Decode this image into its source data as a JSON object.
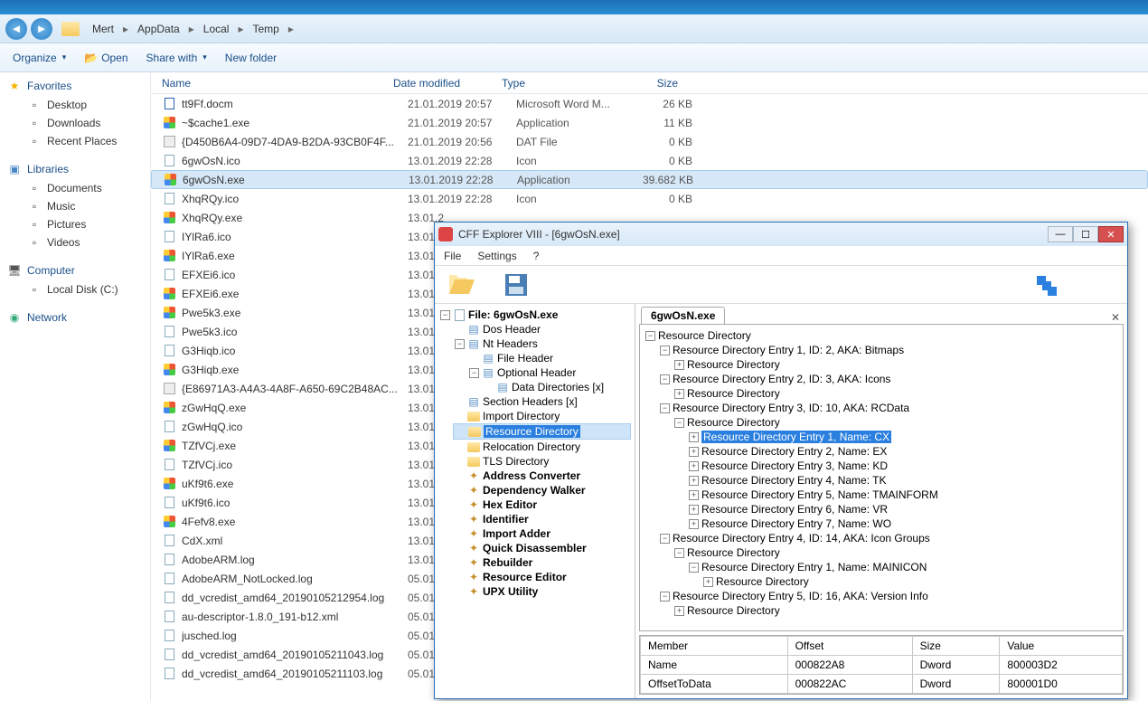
{
  "breadcrumb": [
    "Mert",
    "AppData",
    "Local",
    "Temp"
  ],
  "toolbar": {
    "organize": "Organize",
    "open": "Open",
    "share": "Share with",
    "newfolder": "New folder"
  },
  "sidebar": {
    "favorites": {
      "label": "Favorites",
      "items": [
        "Desktop",
        "Downloads",
        "Recent Places"
      ]
    },
    "libraries": {
      "label": "Libraries",
      "items": [
        "Documents",
        "Music",
        "Pictures",
        "Videos"
      ]
    },
    "computer": {
      "label": "Computer",
      "items": [
        "Local Disk (C:)"
      ]
    },
    "network": {
      "label": "Network"
    }
  },
  "columns": {
    "name": "Name",
    "date": "Date modified",
    "type": "Type",
    "size": "Size"
  },
  "files": [
    {
      "icon": "doc",
      "name": "tt9Ff.docm",
      "date": "21.01.2019 20:57",
      "type": "Microsoft Word M...",
      "size": "26 KB"
    },
    {
      "icon": "app",
      "name": "~$cache1.exe",
      "date": "21.01.2019 20:57",
      "type": "Application",
      "size": "11 KB"
    },
    {
      "icon": "dat",
      "name": "{D450B6A4-09D7-4DA9-B2DA-93CB0F4F...",
      "date": "21.01.2019 20:56",
      "type": "DAT File",
      "size": "0 KB"
    },
    {
      "icon": "file",
      "name": "6gwOsN.ico",
      "date": "13.01.2019 22:28",
      "type": "Icon",
      "size": "0 KB"
    },
    {
      "icon": "chrome",
      "name": "6gwOsN.exe",
      "date": "13.01.2019 22:28",
      "type": "Application",
      "size": "39.682 KB",
      "selected": true
    },
    {
      "icon": "file",
      "name": "XhqRQy.ico",
      "date": "13.01.2019 22:28",
      "type": "Icon",
      "size": "0 KB"
    },
    {
      "icon": "chrome",
      "name": "XhqRQy.exe",
      "date": "13.01.2",
      "type": "",
      "size": ""
    },
    {
      "icon": "file",
      "name": "IYlRa6.ico",
      "date": "13.01.2",
      "type": "",
      "size": ""
    },
    {
      "icon": "chrome",
      "name": "IYlRa6.exe",
      "date": "13.01.2",
      "type": "",
      "size": ""
    },
    {
      "icon": "file",
      "name": "EFXEi6.ico",
      "date": "13.01.2",
      "type": "",
      "size": ""
    },
    {
      "icon": "chrome",
      "name": "EFXEi6.exe",
      "date": "13.01.2",
      "type": "",
      "size": ""
    },
    {
      "icon": "chrome",
      "name": "Pwe5k3.exe",
      "date": "13.01.2",
      "type": "",
      "size": ""
    },
    {
      "icon": "file",
      "name": "Pwe5k3.ico",
      "date": "13.01.2",
      "type": "",
      "size": ""
    },
    {
      "icon": "file",
      "name": "G3Hiqb.ico",
      "date": "13.01.2",
      "type": "",
      "size": ""
    },
    {
      "icon": "chrome",
      "name": "G3Hiqb.exe",
      "date": "13.01.2",
      "type": "",
      "size": ""
    },
    {
      "icon": "dat",
      "name": "{E86971A3-A4A3-4A8F-A650-69C2B48AC...",
      "date": "13.01.2",
      "type": "",
      "size": ""
    },
    {
      "icon": "chrome",
      "name": "zGwHqQ.exe",
      "date": "13.01.2",
      "type": "",
      "size": ""
    },
    {
      "icon": "file",
      "name": "zGwHqQ.ico",
      "date": "13.01.2",
      "type": "",
      "size": ""
    },
    {
      "icon": "chrome",
      "name": "TZfVCj.exe",
      "date": "13.01.2",
      "type": "",
      "size": ""
    },
    {
      "icon": "file",
      "name": "TZfVCj.ico",
      "date": "13.01.2",
      "type": "",
      "size": ""
    },
    {
      "icon": "chrome",
      "name": "uKf9t6.exe",
      "date": "13.01.2",
      "type": "",
      "size": ""
    },
    {
      "icon": "file",
      "name": "uKf9t6.ico",
      "date": "13.01.2",
      "type": "",
      "size": ""
    },
    {
      "icon": "chrome",
      "name": "4Fefv8.exe",
      "date": "13.01.2",
      "type": "",
      "size": ""
    },
    {
      "icon": "file",
      "name": "CdX.xml",
      "date": "13.01.2",
      "type": "",
      "size": ""
    },
    {
      "icon": "file",
      "name": "AdobeARM.log",
      "date": "13.01.2",
      "type": "",
      "size": ""
    },
    {
      "icon": "file",
      "name": "AdobeARM_NotLocked.log",
      "date": "05.01.2",
      "type": "",
      "size": ""
    },
    {
      "icon": "file",
      "name": "dd_vcredist_amd64_20190105212954.log",
      "date": "05.01.2",
      "type": "",
      "size": ""
    },
    {
      "icon": "file",
      "name": "au-descriptor-1.8.0_191-b12.xml",
      "date": "05.01.2",
      "type": "",
      "size": ""
    },
    {
      "icon": "file",
      "name": "jusched.log",
      "date": "05.01.2",
      "type": "",
      "size": ""
    },
    {
      "icon": "file",
      "name": "dd_vcredist_amd64_20190105211043.log",
      "date": "05.01.2",
      "type": "",
      "size": ""
    },
    {
      "icon": "file",
      "name": "dd_vcredist_amd64_20190105211103.log",
      "date": "05.01.2",
      "type": "",
      "size": ""
    }
  ],
  "cff": {
    "title": "CFF Explorer VIII - [6gwOsN.exe]",
    "menu": [
      "File",
      "Settings",
      "?"
    ],
    "tab": "6gwOsN.exe",
    "leftTree": [
      {
        "l": "File: 6gwOsN.exe",
        "b": true,
        "i": "file",
        "c": [
          {
            "l": "Dos Header",
            "i": "hdr"
          },
          {
            "l": "Nt Headers",
            "i": "hdr",
            "c": [
              {
                "l": "File Header",
                "i": "hdr"
              },
              {
                "l": "Optional Header",
                "i": "hdr",
                "c": [
                  {
                    "l": "Data Directories [x]",
                    "i": "hdr"
                  }
                ]
              }
            ]
          },
          {
            "l": "Section Headers [x]",
            "i": "hdr"
          },
          {
            "l": "Import Directory",
            "i": "folder"
          },
          {
            "l": "Resource Directory",
            "i": "folder",
            "sel": true
          },
          {
            "l": "Relocation Directory",
            "i": "folder"
          },
          {
            "l": "TLS Directory",
            "i": "folder"
          },
          {
            "l": "Address Converter",
            "b": true,
            "i": "tool"
          },
          {
            "l": "Dependency Walker",
            "b": true,
            "i": "tool"
          },
          {
            "l": "Hex Editor",
            "b": true,
            "i": "tool"
          },
          {
            "l": "Identifier",
            "b": true,
            "i": "tool"
          },
          {
            "l": "Import Adder",
            "b": true,
            "i": "tool"
          },
          {
            "l": "Quick Disassembler",
            "b": true,
            "i": "tool"
          },
          {
            "l": "Rebuilder",
            "b": true,
            "i": "tool"
          },
          {
            "l": "Resource Editor",
            "b": true,
            "i": "tool"
          },
          {
            "l": "UPX Utility",
            "b": true,
            "i": "tool"
          }
        ]
      }
    ],
    "rightTree": [
      {
        "l": "Resource Directory",
        "c": [
          {
            "l": "Resource Directory Entry 1, ID: 2, AKA: Bitmaps",
            "c": [
              {
                "l": "Resource Directory",
                "leaf": true
              }
            ]
          },
          {
            "l": "Resource Directory Entry 2, ID: 3, AKA: Icons",
            "c": [
              {
                "l": "Resource Directory",
                "leaf": true
              }
            ]
          },
          {
            "l": "Resource Directory Entry 3, ID: 10, AKA: RCData",
            "c": [
              {
                "l": "Resource Directory",
                "c": [
                  {
                    "l": "Resource Directory Entry 1, Name: CX",
                    "sel": true,
                    "leaf": true
                  },
                  {
                    "l": "Resource Directory Entry 2, Name: EX",
                    "leaf": true
                  },
                  {
                    "l": "Resource Directory Entry 3, Name: KD",
                    "leaf": true
                  },
                  {
                    "l": "Resource Directory Entry 4, Name: TK",
                    "leaf": true
                  },
                  {
                    "l": "Resource Directory Entry 5, Name: TMAINFORM",
                    "leaf": true
                  },
                  {
                    "l": "Resource Directory Entry 6, Name: VR",
                    "leaf": true
                  },
                  {
                    "l": "Resource Directory Entry 7, Name: WO",
                    "leaf": true
                  }
                ]
              }
            ]
          },
          {
            "l": "Resource Directory Entry 4, ID: 14, AKA: Icon Groups",
            "c": [
              {
                "l": "Resource Directory",
                "c": [
                  {
                    "l": "Resource Directory Entry 1, Name: MAINICON",
                    "c": [
                      {
                        "l": "Resource Directory",
                        "leaf": true
                      }
                    ]
                  }
                ]
              }
            ]
          },
          {
            "l": "Resource Directory Entry 5, ID: 16, AKA: Version Info",
            "c": [
              {
                "l": "Resource Directory",
                "leaf": true
              }
            ]
          }
        ]
      }
    ],
    "table": {
      "headers": [
        "Member",
        "Offset",
        "Size",
        "Value"
      ],
      "rows": [
        [
          "Name",
          "000822A8",
          "Dword",
          "800003D2"
        ],
        [
          "OffsetToData",
          "000822AC",
          "Dword",
          "800001D0"
        ]
      ]
    }
  }
}
